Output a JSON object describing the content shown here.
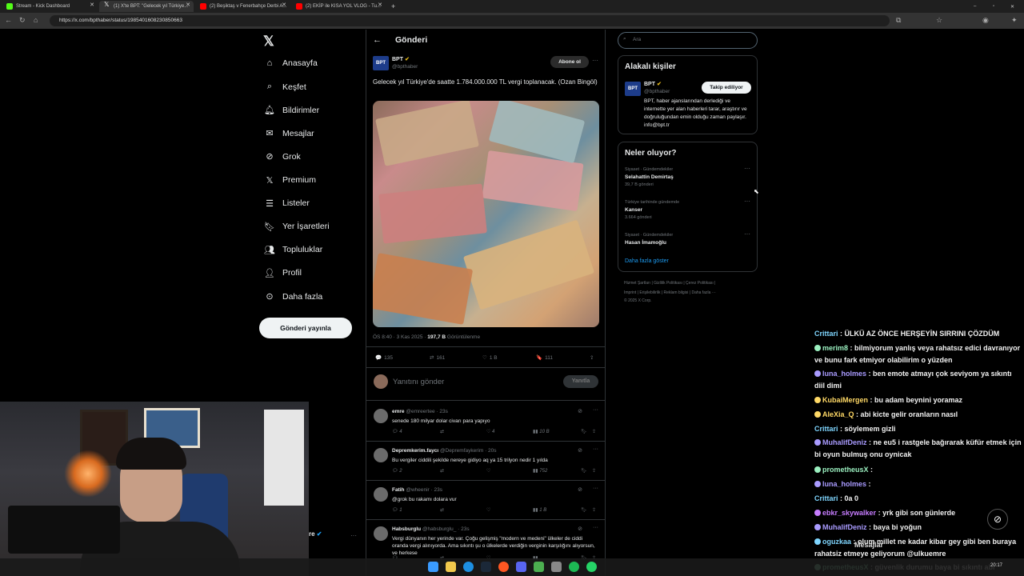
{
  "browser": {
    "tabs": [
      "Stream - Kick Dashboard",
      "(1) X'te BPT: \"Gelecek yıl Türkiye...",
      "(2) Beşiktaş v Fenerbahçe Derbi A...",
      "(2) EKİP ile KISA YOL VLOG - Tu..."
    ],
    "url": "https://x.com/bpthaber/status/1985401608230850663"
  },
  "sidebar": {
    "items": [
      "Anasayfa",
      "Keşfet",
      "Bildirimler",
      "Mesajlar",
      "Grok",
      "Premium",
      "Listeler",
      "Yer İşaretleri",
      "Topluluklar",
      "Profil",
      "Daha fazla"
    ],
    "icons": [
      "home-icon",
      "search-icon",
      "bell-icon",
      "mail-icon",
      "grok-icon",
      "x-icon",
      "list-icon",
      "bookmark-icon",
      "communities-icon",
      "person-icon",
      "more-icon"
    ],
    "post_button": "Gönderi yayınla",
    "account_suffix": "re"
  },
  "post": {
    "header_title": "Gönderi",
    "author": "BPT",
    "handle": "@bpthaber",
    "subscribe": "Abone ol",
    "text": "Gelecek yıl Türkiye'de saatte 1.784.000.000 TL vergi toplanacak. (Ozan Bingöl)",
    "meta": "ÖS 8:40 · 3 Kas 2025 · ",
    "views": "197,7 B",
    "views_label": " Görüntülenme",
    "stats": {
      "replies": "135",
      "reposts": "161",
      "likes": "1 B",
      "bookmarks": "111"
    },
    "reply_placeholder": "Yanıtını gönder",
    "reply_button": "Yanıtla"
  },
  "replies": [
    {
      "name": "emre",
      "handle": "@emreertee · 23s",
      "text": "senede 180 milyar dolar civarı para yapıyo",
      "replies": "4",
      "reposts": "",
      "likes": "4",
      "views": "10 B"
    },
    {
      "name": "Depremkerim.faycı",
      "handle": "@Depremfaykerim · 20s",
      "text": "Bu vergiler ciddili şekilde nereye gidiyo aq ya 15 trilyon nedir 1 yılda",
      "replies": "2",
      "reposts": "",
      "likes": "",
      "views": "752"
    },
    {
      "name": "Fatih",
      "handle": "@wheenir · 23s",
      "text": "@grok bu rakamı dolara vur",
      "replies": "1",
      "reposts": "",
      "likes": "",
      "views": "1 B"
    },
    {
      "name": "Habsburglu",
      "handle": "@habsburglu_ · 23s",
      "text": "Vergi dünyanın her yerinde var. Çoğu gelişmiş \"modern ve medeni\" ülkeler de ciddi oranda vergi alınıyorda. Ama sıkıntı şu o ülkelerde verdiğin verginin karşılığını alıyorsun, ve herkese",
      "replies": "",
      "reposts": "",
      "likes": "",
      "views": ""
    }
  ],
  "right": {
    "search_placeholder": "Ara",
    "related_title": "Alakalı kişiler",
    "related": {
      "name": "BPT",
      "handle": "@bpthaber",
      "button": "Takip ediliyor",
      "bio": "BPT, haber ajanslarından derlediği ve internette yer alan haberleri tarar, araştırır ve doğruluğundan emin olduğu zaman paylaşır. info@bpt.tr"
    },
    "trends_title": "Neler oluyor?",
    "trends": [
      {
        "context": "Siyaset · Gündemdekiler",
        "name": "Selahattin Demirtaş",
        "count": "39,7 B gönderi"
      },
      {
        "context": "Türkiye tarihinde gündemde",
        "name": "Kanser",
        "count": "3.664 gönderi"
      },
      {
        "context": "Siyaset · Gündemdekiler",
        "name": "Hasan İmamoğlu",
        "count": ""
      }
    ],
    "show_more": "Daha fazla göster",
    "footer1": "Hizmet Şartları  |  Gizlilik Politikası  |  Çerez Politikası  |",
    "footer2": "Imprint  |  Erişilebilirlik  |  Reklam bilgisi  |  Daha fazla ···",
    "footer3": "© 2025 X Corp."
  },
  "chat": [
    {
      "user": "Crittari",
      "color": "#7fd6ff",
      "msg": "ÜLKÜ AZ ÖNCE HERŞEYİN SIRRINI ÇÖZDÜM"
    },
    {
      "user": "merim8",
      "color": "#9bf0c0",
      "msg": "bilmiyorum yanlış veya rahatsız edici davranıyor ve bunu fark etmiyor olabilirim o yüzden"
    },
    {
      "user": "luna_holmes",
      "color": "#a99bff",
      "msg": "ben emote atmayı çok seviyom ya sıkıntı diil dimi"
    },
    {
      "user": "KubaiMergen",
      "color": "#ffd966",
      "msg": "bu adam beynini yoramaz"
    },
    {
      "user": "AleXia_Q",
      "color": "#ffd966",
      "msg": "abi kicte gelir oranların nasıl"
    },
    {
      "user": "Crittari",
      "color": "#7fd6ff",
      "msg": "söylemem gizli"
    },
    {
      "user": "MuhalifDeniz",
      "color": "#a99bff",
      "msg": "ne eu5 i rastgele bağırarak küfür etmek için bi oyun bulmuş onu oynicak"
    },
    {
      "user": "prometheusX",
      "color": "#9bf0c0",
      "msg": ""
    },
    {
      "user": "luna_holmes",
      "color": "#a99bff",
      "msg": ""
    },
    {
      "user": "Crittari",
      "color": "#7fd6ff",
      "msg": "0a 0"
    },
    {
      "user": "ebkr_skywalker",
      "color": "#c77dff",
      "msg": "yrk gibi son günlerde"
    },
    {
      "user": "MuhalifDeniz",
      "color": "#a99bff",
      "msg": "baya bi yoğun"
    },
    {
      "user": "oguzkaa",
      "color": "#7fd6ff",
      "msg": "olum millet ne kadar kibar gey gibi ben buraya rahatsiz etmeye geliyorum @ulkuemre"
    },
    {
      "user": "prometheusX",
      "color": "#9bf0c0",
      "msg": "güvenlik durumu baya bi sıkıntı abi"
    }
  ],
  "overlay": {
    "messages_label": "Mesajlar"
  },
  "clock": "20:17"
}
